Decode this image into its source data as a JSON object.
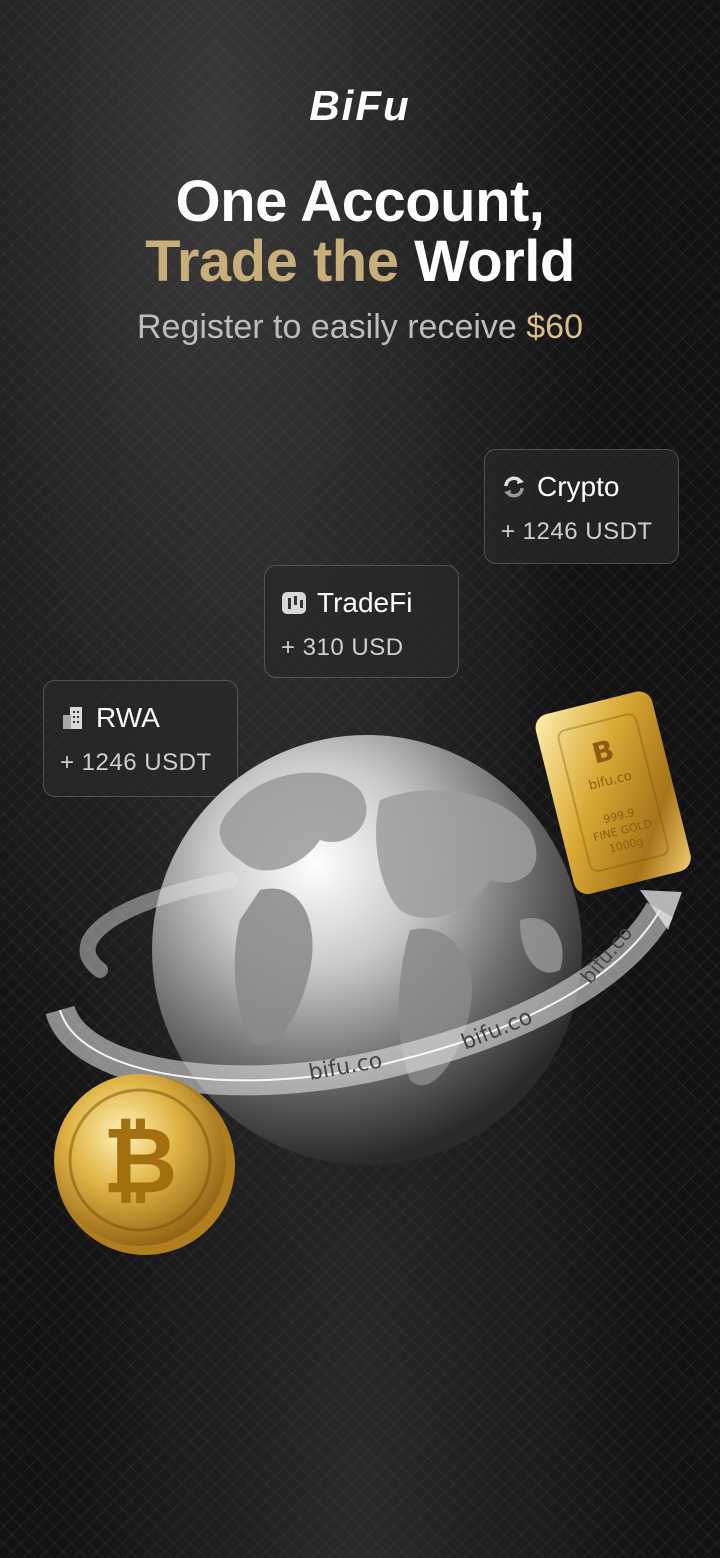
{
  "brand": {
    "logo_text": "BiFu"
  },
  "headline": {
    "line1": "One Account,",
    "line2_highlight": "Trade the",
    "line2_rest": "World"
  },
  "subtitle": {
    "text": "Register to easily receive",
    "amount": "$60"
  },
  "cards": {
    "crypto": {
      "title": "Crypto",
      "amount": "+ 1246 USDT",
      "icon": "crypto-refresh-icon"
    },
    "tradefi": {
      "title": "TradeFi",
      "amount": "+ 310 USD",
      "icon": "tradefi-chart-icon"
    },
    "rwa": {
      "title": "RWA",
      "amount": "+ 1246 USDT",
      "icon": "rwa-building-icon"
    }
  },
  "illustration": {
    "ring_labels": [
      "bifu.co",
      "bifu.co",
      "bifu.co"
    ],
    "gold_bar": {
      "brand": "bifu.co",
      "purity": "999.9",
      "line": "FINE GOLD",
      "weight": "1000g"
    }
  },
  "colors": {
    "gold": "#c8ae7a",
    "gold_light": "#d9c089",
    "background": "#121212"
  }
}
